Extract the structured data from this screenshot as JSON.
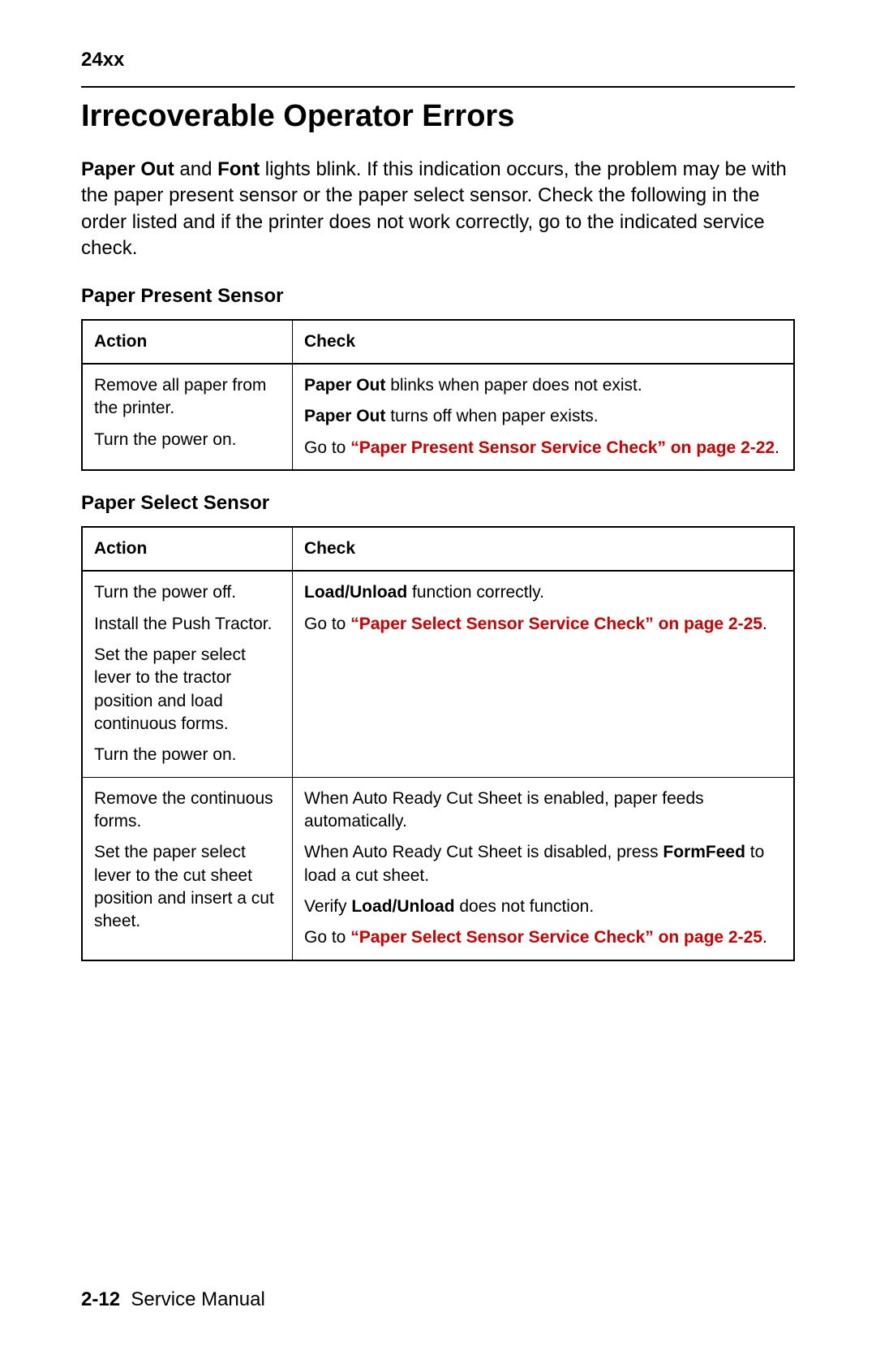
{
  "header": {
    "model": "24xx"
  },
  "title": "Irrecoverable Operator Errors",
  "intro": {
    "b1": "Paper Out",
    "mid1": " and ",
    "b2": "Font",
    "rest": " lights blink. If this indication occurs, the problem may be with the paper present sensor or the paper select sensor. Check the following in the order listed and if the printer does not work correctly, go to the indicated service check."
  },
  "table1": {
    "heading": "Paper Present Sensor",
    "cols": {
      "action": "Action",
      "check": "Check"
    },
    "row": {
      "action": {
        "p1": "Remove all paper from the printer.",
        "p2": "Turn the power on."
      },
      "check": {
        "p1_b": "Paper Out",
        "p1_rest": " blinks when paper does not exist.",
        "p2_b": "Paper Out",
        "p2_rest": " turns off when paper exists.",
        "p3_pre": "Go to ",
        "p3_link": "“Paper Present Sensor Service Check” on page 2-22",
        "p3_post": "."
      }
    }
  },
  "table2": {
    "heading": "Paper Select Sensor",
    "cols": {
      "action": "Action",
      "check": "Check"
    },
    "rows": [
      {
        "action": {
          "p1": "Turn the power off.",
          "p2": "Install the Push Tractor.",
          "p3": "Set the paper select lever to the tractor position and load continuous forms.",
          "p4": "Turn the power on."
        },
        "check": {
          "p1_b": "Load/Unload",
          "p1_rest": " function correctly.",
          "p2_pre": "Go to ",
          "p2_link": "“Paper Select Sensor Service Check” on page 2-25",
          "p2_post": "."
        }
      },
      {
        "action": {
          "p1": "Remove the continuous forms.",
          "p2": "Set the paper select lever to the cut sheet position and insert a cut sheet."
        },
        "check": {
          "p1": "When Auto Ready Cut Sheet is enabled, paper feeds automatically.",
          "p2_pre": "When Auto Ready Cut Sheet is disabled, press ",
          "p2_b": "FormFeed",
          "p2_post": " to load a cut sheet.",
          "p3_pre": "Verify ",
          "p3_b": "Load/Unload",
          "p3_post": " does not function.",
          "p4_pre": "Go to ",
          "p4_link": "“Paper Select Sensor Service Check” on page 2-25",
          "p4_post": "."
        }
      }
    ]
  },
  "footer": {
    "pagenum": "2-12",
    "label": "Service Manual"
  }
}
